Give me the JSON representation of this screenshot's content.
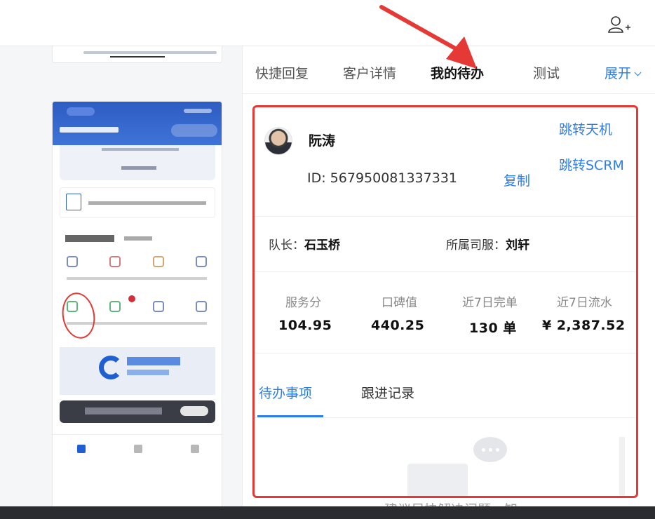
{
  "colors": {
    "accent": "#2b7de9",
    "annotation": "#e53935"
  },
  "tabs": [
    {
      "label": "快捷回复"
    },
    {
      "label": "客户详情"
    },
    {
      "label": "我的待办"
    },
    {
      "label": "测试"
    },
    {
      "label": "展开"
    }
  ],
  "customer": {
    "name": "阮涛",
    "id_text": "ID: 567950081337331",
    "copy_label": "复制",
    "link_tianji": "跳转天机",
    "link_scrm": "跳转SCRM",
    "captain_label": "队长：",
    "captain_name": "石玉桥",
    "driver_label": "所属司服：",
    "driver_name": "刘轩"
  },
  "stats": [
    {
      "label": "服务分",
      "value": "104.95"
    },
    {
      "label": "口碑值",
      "value": "440.25"
    },
    {
      "label": "近7日完单",
      "value": "130 单"
    },
    {
      "label": "近7日流水",
      "value": "¥ 2,387.52"
    }
  ],
  "subtabs": [
    {
      "label": "待办事项"
    },
    {
      "label": "跟进记录"
    }
  ],
  "bottom_hint": "建议尽快解决问题，知"
}
